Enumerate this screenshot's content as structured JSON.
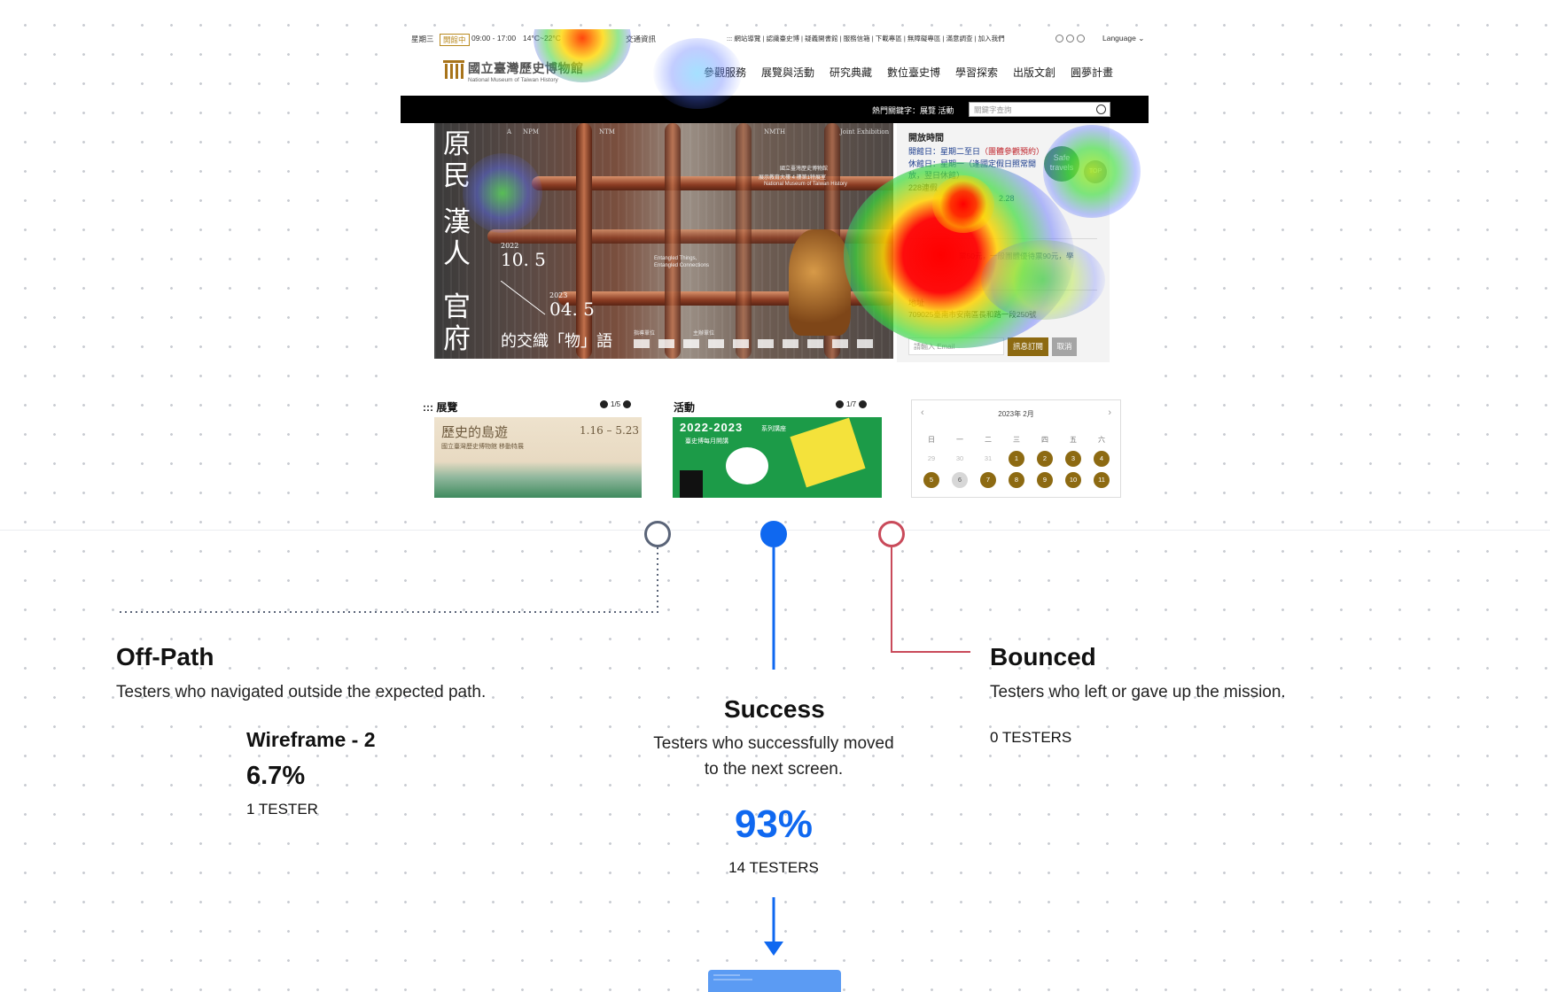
{
  "site": {
    "topbar": {
      "day": "星期三",
      "status_badge": "開館中",
      "hours": "09:00 - 17:00",
      "temp": "14°C~22°C",
      "traffic": "交通資訊",
      "links": "::: 網站導覽 | 認識臺史博 | 疑義開書館 | 服務信箱 | 下載專區 | 無障礙專區 | 滿意調查 | 加入我們",
      "language": "Language"
    },
    "logo": {
      "cn": "國立臺灣歷史博物館",
      "en": "National Museum of Taiwan History"
    },
    "nav": [
      "參觀服務",
      "展覽與活動",
      "研究典藏",
      "數位臺史博",
      "學習探索",
      "出版文創",
      "圓夢計畫"
    ],
    "search": {
      "hot_label": "熱門關鍵字：展覽 活動",
      "placeholder": "關鍵字查詢"
    },
    "banner": {
      "col1": "原民",
      "col2": "漢人",
      "col3": "官府",
      "year1": "2022",
      "date1": "10. 5",
      "year2": "2023",
      "date2": "04. 5",
      "subtitle": "的交織「物」語",
      "tag_a": "A",
      "tag_npm": "NPM",
      "tag_ntm": "NTM",
      "tag_nmth": "NMTH",
      "tag_joint": "Joint Exhibition",
      "inst_cn": "國立臺灣歷史博物館",
      "inst_line": "展示教育大樓 4 樓第1特展室",
      "inst_en": "National Museum of Taiwan History",
      "entangled1": "Entangled Things,",
      "entangled2": "Entangled Connections",
      "host": "指導單位",
      "org": "主辦單位"
    },
    "info": {
      "title": "開放時間",
      "open_label": "開館日：星期二至日",
      "reserve": "（團體參觀預約）",
      "closed1": "休館日：星期一（逢國定假日照常開",
      "closed2": "放，翌日休館）",
      "holiday": "228連假",
      "holiday_date": "2.28",
      "ticket": "票50元，一般團體優待票90元，學",
      "addr_label": "地址",
      "addr": "709025臺南市安南區長和路一段250號",
      "email_placeholder": "請輸入 Email",
      "subscribe": "訊息訂閱",
      "cancel": "取消",
      "safe": "Safe travels",
      "top": "TOP"
    },
    "exhibit": {
      "title": "::: 展覽",
      "pager": "1/5",
      "card_title": "歷史的島遊",
      "card_dates": "1.16 – 5.23",
      "card_sub": "國立臺灣歷史博物館 移動特展"
    },
    "activity": {
      "title": "活動",
      "pager": "1/7",
      "card_title": "2022-2023",
      "card_tag": "系列講座",
      "card_sub": "臺史博每月開講"
    },
    "calendar": {
      "header": "2023年 2月",
      "weekdays": [
        "日",
        "一",
        "二",
        "三",
        "四",
        "五",
        "六"
      ],
      "row1": [
        "29",
        "30",
        "31",
        "1",
        "2",
        "3",
        "4"
      ],
      "row2": [
        "5",
        "6",
        "7",
        "8",
        "9",
        "10",
        "11"
      ]
    }
  },
  "flow": {
    "offpath": {
      "title": "Off-Path",
      "desc": "Testers who navigated outside the expected path.",
      "screen": "Wireframe - 2",
      "pct": "6.7%",
      "count": "1 TESTER",
      "color": "#5a6478"
    },
    "success": {
      "title": "Success",
      "desc1": "Testers who successfully moved",
      "desc2": "to the next screen.",
      "pct": "93%",
      "count": "14 TESTERS",
      "color": "#0f68f0"
    },
    "bounced": {
      "title": "Bounced",
      "desc": "Testers who left or gave up the mission.",
      "count": "0 TESTERS",
      "color": "#c94a5a"
    }
  }
}
